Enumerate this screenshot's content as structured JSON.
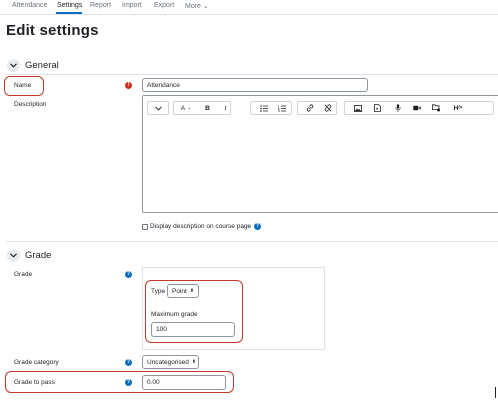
{
  "nav": {
    "tabs": [
      {
        "label": "Attendance"
      },
      {
        "label": "Settings"
      },
      {
        "label": "Report"
      },
      {
        "label": "Import"
      },
      {
        "label": "Export"
      },
      {
        "label": "More"
      }
    ],
    "active_tab": "Settings"
  },
  "page": {
    "title": "Edit settings"
  },
  "general": {
    "section_title": "General",
    "name": {
      "label": "Name",
      "value": "Attendance",
      "required": true
    },
    "description": {
      "label": "Description",
      "toolbar": [
        "expand",
        "paragraph-styles",
        "bold",
        "italic",
        "unordered-list",
        "ordered-list",
        "link",
        "unlink",
        "image",
        "media",
        "record-audio",
        "record-video",
        "manage-files",
        "html"
      ],
      "toolbar_text": {
        "styles": "A",
        "bold": "B",
        "italic": "I",
        "html": "H"
      },
      "value": ""
    },
    "display_on_course": {
      "label": "Display description on course page",
      "checked": false
    }
  },
  "grade": {
    "section_title": "Grade",
    "grade": {
      "label": "Grade",
      "type_label": "Type",
      "type_value": "Point",
      "max_label": "Maximum grade",
      "max_value": "100"
    },
    "category": {
      "label": "Grade category",
      "value": "Uncategorised"
    },
    "to_pass": {
      "label": "Grade to pass",
      "value": "0.00"
    }
  },
  "colors": {
    "accent": "#0f6cbf",
    "required": "#ca3120",
    "highlight": "#c0392b"
  }
}
